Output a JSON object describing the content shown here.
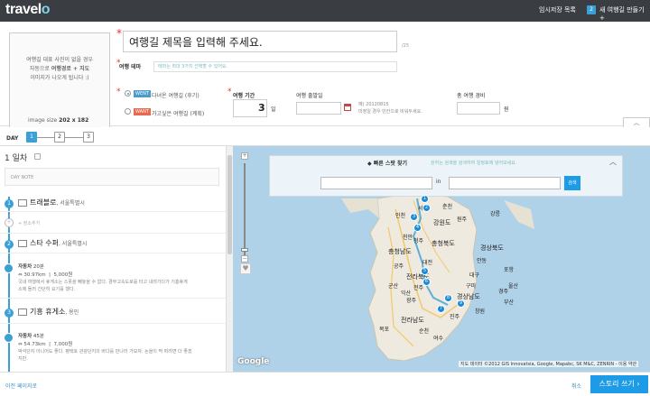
{
  "topbar": {
    "logo_pre": "travel",
    "logo_o": "o",
    "temp_save": "임시저장 목록",
    "temp_count": "2",
    "new_trip": "새 여행길 만들기 +"
  },
  "photo": {
    "note_line1": "여행길 대표 사진이 없을 경우",
    "note_line2a": "자동으로 ",
    "note_line2b": "여행경로 + 지도",
    "note_line3": "이미지가 나오게 됩니다 :)",
    "size_label": "image size ",
    "size_value": "202 x 182"
  },
  "form": {
    "title_value": "여행길 제목을 입력해 주세요.",
    "title_count": "/25",
    "theme_label": "여행 테마",
    "theme_placeholder": "테마는 최대 3가지 선택할 수 있어요.",
    "went_badge": "WENT",
    "went_text": "다녀온 여행길 (후기)",
    "want_badge": "WANT",
    "want_text": "가고싶은 여행길 (계획)",
    "period_label": "여행 기간",
    "period_value": "3",
    "period_unit": "일",
    "start_label": "여행 출발일",
    "start_hint1": "예) 20120815",
    "start_hint2": "미정일 경우 빈칸으로 비워두세요.",
    "cost_label": "총 여행 경비",
    "cost_unit": "원",
    "collapse": "︿"
  },
  "daybar": {
    "label": "DAY",
    "days": [
      "1",
      "2",
      "3"
    ]
  },
  "itinerary": {
    "day_title": "1 일차",
    "day_note": "DAY NOTE",
    "add_place": "+ 장소추가",
    "places": [
      {
        "num": "1",
        "name": "트래블로",
        "sub": ", 서울특별시"
      },
      {
        "num": "2",
        "name": "스타 수퍼",
        "sub": ", 서울특별시"
      },
      {
        "num": "3",
        "name": "기흥 휴게소",
        "sub": ", 용인"
      }
    ],
    "moves": [
      {
        "mode": "자동차",
        "time": " 20분",
        "dist": "30.97km",
        "cost": "5,000원",
        "note1": "국내 여행에서 휴게소는 스폿을 빼놓을 수 없다. 경부고속도로를 타고 내려가다가 기흥휴게",
        "note2": "소에 들러 간단히 요기를 했다."
      },
      {
        "mode": "자동차",
        "time": " 45분",
        "dist": "54.73km",
        "cost": "7,000원",
        "note1": "박석단지 아니어도 좋다. 평택호 관광단지의 바다를 만나러 가보자. 논을이 딱 떠려면 더 좋겠",
        "note2": "지만."
      }
    ]
  },
  "map": {
    "quick_title": "빠른 스팟 찾기",
    "quick_hint": "원하는 검색을 검색하여 일정표에 넣어보세요.",
    "quick_in": "in",
    "quick_go": "검색",
    "quick_close": "︿",
    "google": "Google",
    "attribution": "지도 데이터 ©2012 GIS Innovatsia, Google, Mapabc, SK M&C, ZENRIN - 이용 약관",
    "labels": [
      "강원도",
      "서울",
      "인천",
      "충청북도",
      "충청남도",
      "경상북도",
      "대전",
      "전라북도",
      "대구",
      "경상남도",
      "광주",
      "부산",
      "전라남도",
      "울산",
      "안동",
      "포항",
      "청주",
      "천안",
      "춘천",
      "원주",
      "강릉",
      "전주",
      "목포",
      "여수",
      "진주",
      "창원",
      "경주",
      "공주",
      "구미",
      "군산",
      "익산",
      "순천"
    ],
    "pins": [
      "1",
      "2",
      "3",
      "4",
      "5",
      "6",
      "7",
      "8",
      "9"
    ]
  },
  "bottom": {
    "back": "이전 페이지로",
    "cancel": "취소",
    "story": "스토리 쓰기 ›"
  }
}
